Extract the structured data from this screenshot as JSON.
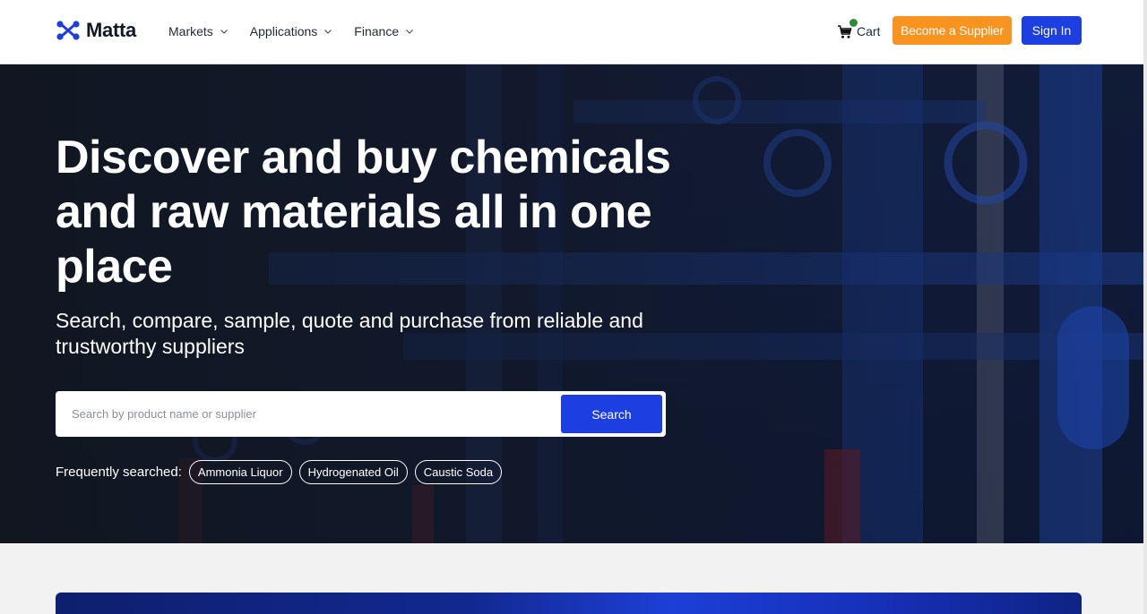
{
  "header": {
    "logo_text": "Matta",
    "nav": [
      {
        "label": "Markets"
      },
      {
        "label": "Applications"
      },
      {
        "label": "Finance"
      }
    ],
    "cart_label": "Cart",
    "become_supplier_label": "Become a Supplier",
    "sign_in_label": "Sign In"
  },
  "hero": {
    "title": "Discover and buy chemicals and raw materials all in one place",
    "subtitle": "Search, compare, sample, quote and purchase from reliable and trustworthy suppliers",
    "search": {
      "placeholder": "Search by product name or supplier",
      "value": "",
      "button_label": "Search"
    },
    "frequently_searched": {
      "label": "Frequently searched:",
      "chips": [
        "Ammonia Liquor",
        "Hydrogenated Oil",
        "Caustic Soda"
      ]
    }
  },
  "colors": {
    "accent_blue": "#1d3ee0",
    "supplier_orange": "#f7931e",
    "cart_badge_green": "#2e8b3a"
  },
  "icons": {
    "logo": "molecule-logo-icon",
    "nav_dropdown": "chevron-down-icon",
    "cart": "shopping-cart-icon"
  }
}
